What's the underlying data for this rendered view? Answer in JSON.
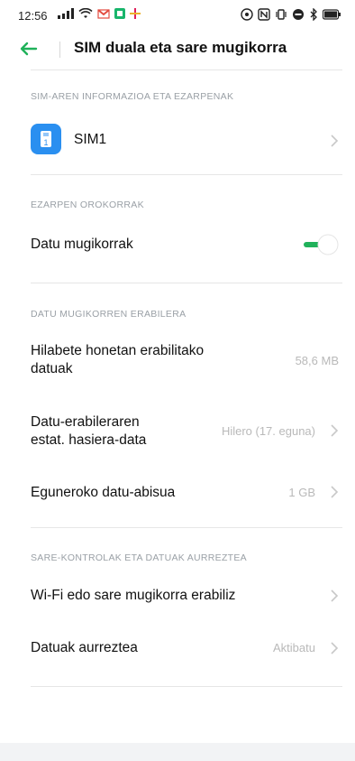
{
  "status": {
    "time": "12:56",
    "left_icons": [
      "signal-icon",
      "wifi-icon",
      "gmail-icon",
      "app-icon",
      "slack-icon"
    ],
    "right_icons": [
      "nfc-icon",
      "n-icon",
      "vibrate-icon",
      "do-not-disturb-icon",
      "bluetooth-icon",
      "battery-icon"
    ]
  },
  "header": {
    "title": "SIM duala eta sare mugikorra"
  },
  "sections": {
    "sim_info": {
      "label": "SIM-AREN INFORMAZIOA ETA EZARPENAK",
      "sim1_label": "SIM1"
    },
    "general": {
      "label": "EZARPEN OROKORRAK",
      "mobile_data_label": "Datu mugikorrak",
      "mobile_data_on": true
    },
    "usage": {
      "label": "DATU MUGIKORREN ERABILERA",
      "monthly_label_1": "Hilabete honetan erabilitako",
      "monthly_label_2": "datuak",
      "monthly_value": "58,6 MB",
      "reset_label_1": "Datu-erabileraren",
      "reset_label_2": "estat. hasiera-data",
      "reset_value": "Hilero (17. eguna)",
      "daily_label": "Eguneroko datu-abisua",
      "daily_value": "1 GB"
    },
    "network": {
      "label": "SARE-KONTROLAK ETA DATUAK AURREZTEA",
      "wifi_or_mobile_label": "Wi-Fi edo sare mugikorra erabiliz",
      "data_saver_label": "Datuak aurreztea",
      "data_saver_value": "Aktibatu"
    }
  },
  "colors": {
    "accent": "#20b15a",
    "sim_icon": "#2a8ff0"
  }
}
